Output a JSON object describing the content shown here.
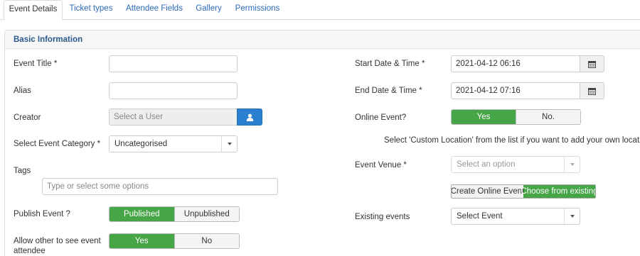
{
  "tabs": [
    {
      "label": "Event Details",
      "active": true
    },
    {
      "label": "Ticket types",
      "active": false
    },
    {
      "label": "Attendee Fields",
      "active": false
    },
    {
      "label": "Gallery",
      "active": false
    },
    {
      "label": "Permissions",
      "active": false
    }
  ],
  "section": {
    "title": "Basic Information"
  },
  "left": {
    "event_title": {
      "label": "Event Title *",
      "value": ""
    },
    "alias": {
      "label": "Alias",
      "value": ""
    },
    "creator": {
      "label": "Creator",
      "placeholder": "Select a User",
      "button_icon": "user-icon"
    },
    "category": {
      "label": "Select Event Category *",
      "value": "Uncategorised"
    },
    "tags": {
      "label": "Tags",
      "placeholder": "Type or select some options"
    },
    "publish": {
      "label": "Publish Event ?",
      "options": [
        "Published",
        "Unpublished"
      ],
      "selected": "Published"
    },
    "allow_attendee": {
      "label": "Allow other to see event attendee",
      "options": [
        "Yes",
        "No"
      ],
      "selected": "Yes"
    }
  },
  "right": {
    "start": {
      "label": "Start Date & Time *",
      "value": "2021-04-12 06:16",
      "icon": "calendar-icon"
    },
    "end": {
      "label": "End Date & Time *",
      "value": "2021-04-12 07:16",
      "icon": "calendar-icon"
    },
    "online": {
      "label": "Online Event?",
      "options": [
        "Yes",
        "No."
      ],
      "selected": "Yes"
    },
    "custom_location_note": "Select 'Custom Location' from the list if you want to add your own location",
    "venue": {
      "label": "Event Venue *",
      "placeholder": "Select an option"
    },
    "online_buttons": {
      "create": "Create Online Event",
      "choose": "Choose from existing",
      "selected": "choose"
    },
    "existing": {
      "label": "Existing events",
      "value": "Select Event"
    }
  },
  "colors": {
    "accent": "#2a69b8",
    "success": "#46a546",
    "user_button": "#2a7fcf"
  }
}
